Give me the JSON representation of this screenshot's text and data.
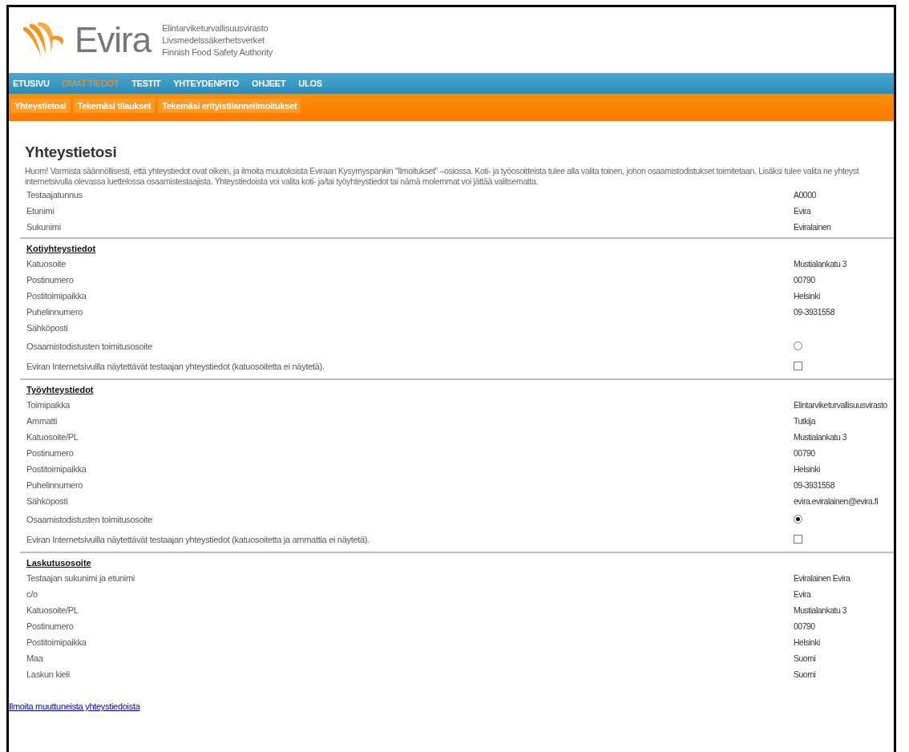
{
  "header": {
    "logo_text": "Evira",
    "agency_names": [
      "Elintarviketurvallisuusvirasto",
      "Livsmedelssäkerhetsverket",
      "Finnish Food Safety Authority"
    ]
  },
  "nav": [
    {
      "label": "ETUSIVU",
      "selected": false
    },
    {
      "label": "OMAT TIEDOT",
      "selected": true
    },
    {
      "label": "TESTIT",
      "selected": false
    },
    {
      "label": "YHTEYDENPITO",
      "selected": false
    },
    {
      "label": "OHJEET",
      "selected": false
    },
    {
      "label": "ULOS",
      "selected": false
    }
  ],
  "subnav": [
    {
      "label": "Yhteystietosi"
    },
    {
      "label": "Tekemäsi tilaukset"
    },
    {
      "label": "Tekemäsi erityistilanneilmoitukset"
    }
  ],
  "title": "Yhteystietosi",
  "intro_lines": [
    "Huom! Varmista säännöllisesti, että yhteystiedot ovat oikein, ja ilmoita muutoksista Eviraan Kysymyspankin \"Ilmoitukset\" –osiossa. Koti- ja työosoitteista tulee alla valita toinen, johon osaamistodistukset toimitetaan. Lisäksi tulee valita ne yhteyst",
    "internetsivulla olevassa luettelossa osaamistestaajista. Yhteystiedoista voi valita koti- ja/tai työyhteystiedot tai nämä molemmat voi jättää valitsematta."
  ],
  "sections": [
    {
      "rows": [
        {
          "kind": "text",
          "label": "Testaajatunnus",
          "value": "A0000"
        },
        {
          "kind": "text",
          "label": "Etunimi",
          "value": "Evira"
        },
        {
          "kind": "text",
          "label": "Sukunimi",
          "value": "Eviralainen"
        }
      ]
    },
    {
      "heading": "Kotiyhteystiedot",
      "rows": [
        {
          "kind": "text",
          "label": "Katuosoite",
          "value": "Mustialankatu 3"
        },
        {
          "kind": "text",
          "label": "Postinumero",
          "value": "00790"
        },
        {
          "kind": "text",
          "label": "Postitoimipaikka",
          "value": "Helsinki"
        },
        {
          "kind": "text",
          "label": "Puhelinnumero",
          "value": "09-3931558"
        },
        {
          "kind": "text",
          "label": "Sähköposti"
        },
        {
          "kind": "radio",
          "label": "Osaamistodistusten toimitusosoite",
          "selected": false
        },
        {
          "kind": "checkbox",
          "label": "Eviran Internetsivuilla näytettävät testaajan yhteystiedot (katuosoitetta ei näytetä).",
          "checked": false
        }
      ]
    },
    {
      "heading": "Työyhteystiedot",
      "rows": [
        {
          "kind": "text",
          "label": "Toimipaikka",
          "value": "Elintarviketurvallisuusvirasto"
        },
        {
          "kind": "text",
          "label": "Ammatti",
          "value": "Tutkija"
        },
        {
          "kind": "text",
          "label": "Katuosoite/PL",
          "value": "Mustialankatu 3"
        },
        {
          "kind": "text",
          "label": "Postinumero",
          "value": "00790"
        },
        {
          "kind": "text",
          "label": "Postitoimipaikka",
          "value": "Helsinki"
        },
        {
          "kind": "text",
          "label": "Puhelinnumero",
          "value": "09-3931558"
        },
        {
          "kind": "text",
          "label": "Sähköposti",
          "value": "evira.eviralainen@evira.fi"
        },
        {
          "kind": "radio",
          "label": "Osaamistodistusten toimitusosoite",
          "selected": true
        },
        {
          "kind": "checkbox",
          "label": "Eviran Internetsivuilla näytettävät testaajan yhteystiedot (katuosoitetta ja ammattia ei näytetä).",
          "checked": false
        }
      ]
    },
    {
      "heading": "Laskutusosoite",
      "rows": [
        {
          "kind": "text",
          "label": "Testaajan sukunimi ja etunimi",
          "value": "Eviralainen Evira"
        },
        {
          "kind": "text",
          "label": "c/o",
          "value": "Evira"
        },
        {
          "kind": "text",
          "label": "Katuosoite/PL",
          "value": "Mustialankatu 3"
        },
        {
          "kind": "text",
          "label": "Postinumero",
          "value": "00790"
        },
        {
          "kind": "text",
          "label": "Postitoimipaikka",
          "value": "Helsinki"
        },
        {
          "kind": "text",
          "label": "Maa",
          "value": "Suomi"
        },
        {
          "kind": "text",
          "label": "Laskun kieli",
          "value": "Suomi"
        }
      ]
    }
  ],
  "footer_link": "Ilmoita muuttuneista yhteystiedoista"
}
